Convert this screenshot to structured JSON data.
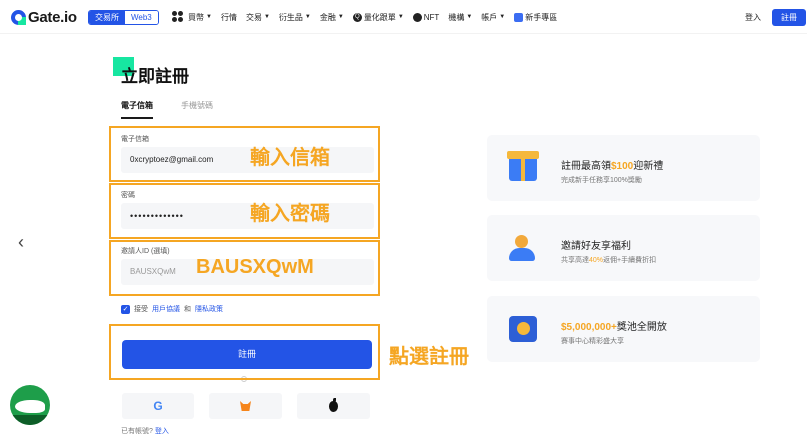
{
  "nav": {
    "logo": "Gate.io",
    "mode_a": "交易所",
    "mode_b": "Web3",
    "items": [
      "買幣",
      "行情",
      "交易",
      "衍生品",
      "金融",
      "量化跟單",
      "NFT",
      "機構",
      "帳戶",
      "新手專區"
    ],
    "login": "登入",
    "register": "註冊"
  },
  "form": {
    "title": "立即註冊",
    "tab_email": "電子信箱",
    "tab_phone": "手機號碼",
    "email_label": "電子信箱",
    "email_value": "0xcryptoez@gmail.com",
    "password_label": "密碼",
    "password_value": "•••••••••••••",
    "referral_label": "邀請人ID (選填)",
    "referral_value": "BAUSXQwM",
    "agree_prefix": "接受",
    "agree_terms": "用戶協議",
    "agree_and": "和",
    "agree_privacy": "隱私政策",
    "submit": "註冊",
    "have_account": "已有帳號?",
    "login_link": "登入"
  },
  "annotations": {
    "email": "輸入信箱",
    "password": "輸入密碼",
    "referral": "BAUSXQwM",
    "submit": "點選註冊"
  },
  "promos": [
    {
      "title_pre": "註冊最高領",
      "title_highlight": "$100",
      "title_post": "迎新禮",
      "sub_pre": "完成新手任務享100%",
      "sub_highlight": "",
      "sub_post": "獎勵"
    },
    {
      "title_pre": "邀請好友享福利",
      "title_highlight": "",
      "title_post": "",
      "sub_pre": "共享高達",
      "sub_highlight": "40%",
      "sub_post": "返佣+手續費折扣"
    },
    {
      "title_pre": "",
      "title_highlight": "$5,000,000+",
      "title_post": "獎池全開放",
      "sub_pre": "賽事中心精彩盛大享",
      "sub_highlight": "",
      "sub_post": ""
    }
  ],
  "colors": {
    "primary": "#2354e6",
    "accent_green": "#17e6a1",
    "annotation_orange": "#f5a623"
  }
}
